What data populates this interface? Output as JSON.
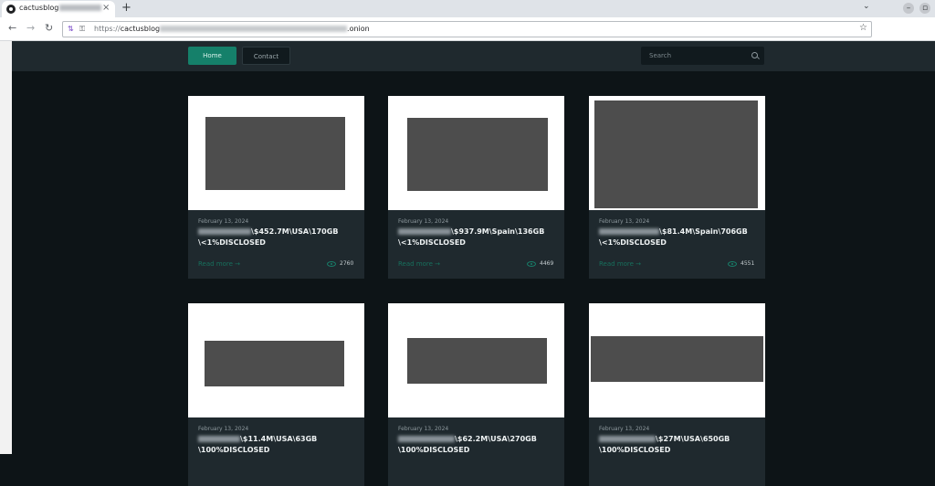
{
  "browser": {
    "tab_title": "cactusblog",
    "tab_close": "×",
    "new_tab": "+",
    "dropdown": "⌄",
    "minimize": "–",
    "restore": "▫",
    "url_protocol": "https://",
    "url_host_start": "cactusblog",
    "url_host_end": ".onion",
    "back": "←",
    "forward": "→",
    "reload": "↻",
    "bookmark": "☆"
  },
  "site_nav": {
    "home_label": "Home",
    "contact_label": "Contact",
    "search_placeholder": "Search"
  },
  "cards": [
    {
      "date": "February 13, 2024",
      "title_line1": "\\$452.7M\\USA\\170GB",
      "title_line2": "\\<1%DISCLOSED",
      "read_more": "Read more →",
      "views": "2760"
    },
    {
      "date": "February 13, 2024",
      "title_line1": "\\$937.9M\\Spain\\136GB",
      "title_line2": "\\<1%DISCLOSED",
      "read_more": "Read more →",
      "views": "4469"
    },
    {
      "date": "February 13, 2024",
      "title_line1": "\\$81.4M\\Spain\\706GB",
      "title_line2": "\\<1%DISCLOSED",
      "read_more": "Read more →",
      "views": "4551"
    },
    {
      "date": "February 13, 2024",
      "title_line1": "\\$11.4M\\USA\\63GB",
      "title_line2": "\\100%DISCLOSED",
      "read_more": "",
      "views": ""
    },
    {
      "date": "February 13, 2024",
      "title_line1": "\\$62.2M\\USA\\270GB",
      "title_line2": "\\100%DISCLOSED",
      "read_more": "",
      "views": ""
    },
    {
      "date": "February 13, 2024",
      "title_line1": "\\$27M\\USA\\650GB",
      "title_line2": "\\100%DISCLOSED",
      "read_more": "",
      "views": ""
    }
  ],
  "colors": {
    "page_bg": "#0d1417",
    "nav_bg": "#1f292e",
    "accent": "#15806a",
    "card_body": "#1f292e",
    "image_placeholder": "#4d4d4d"
  }
}
